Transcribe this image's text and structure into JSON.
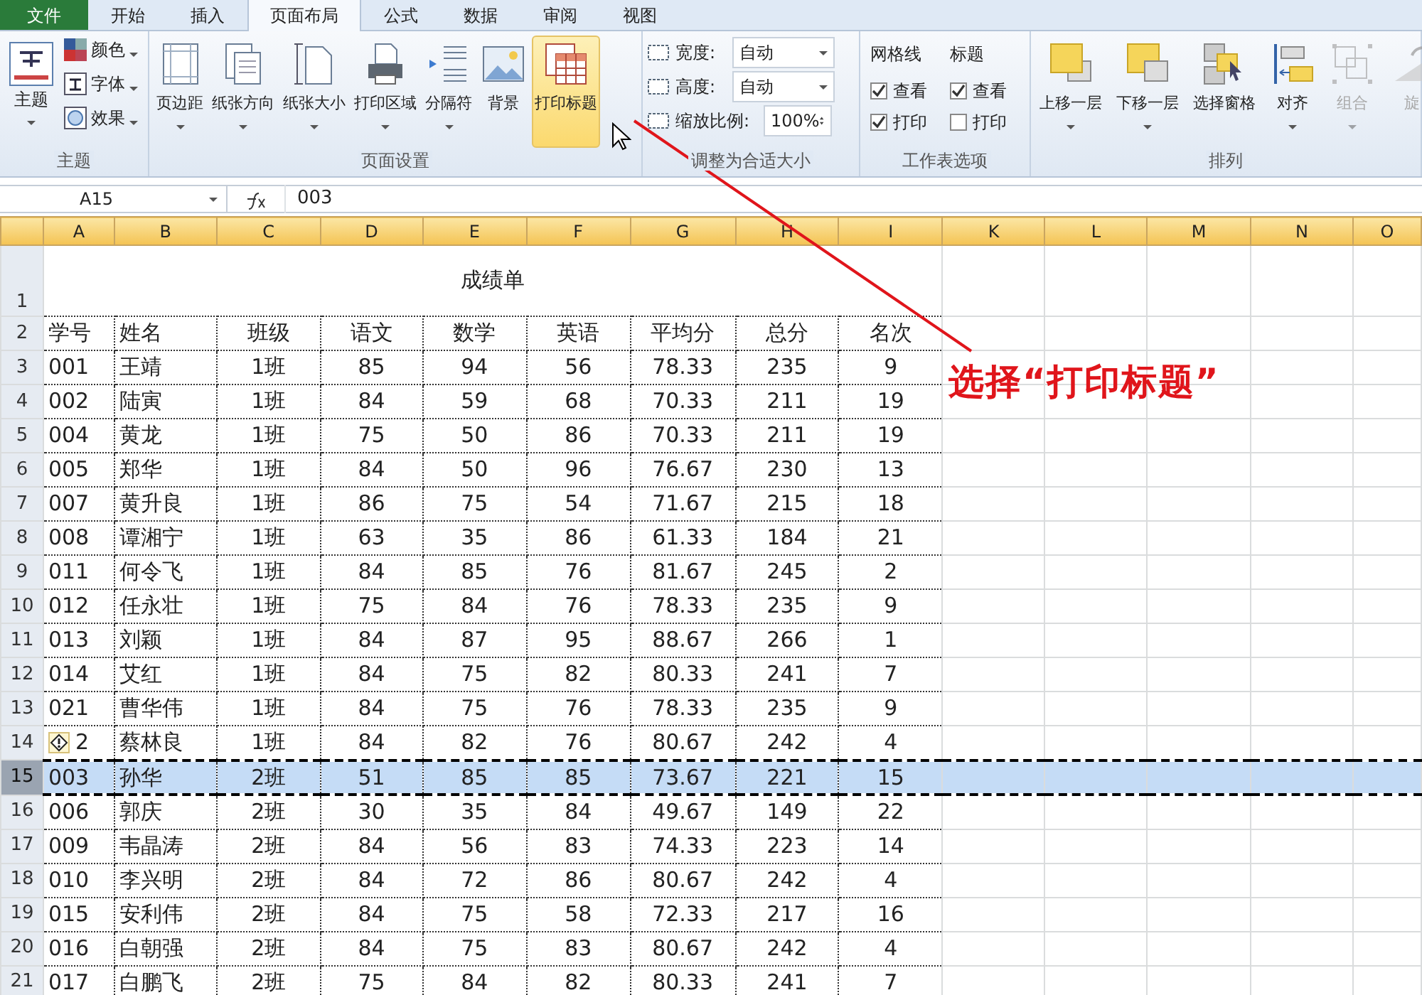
{
  "menu_tabs": [
    {
      "label": "文件",
      "kind": "file",
      "selected": false
    },
    {
      "label": "开始",
      "kind": "tab",
      "selected": false
    },
    {
      "label": "插入",
      "kind": "tab",
      "selected": false
    },
    {
      "label": "页面布局",
      "kind": "tab",
      "selected": true
    },
    {
      "label": "公式",
      "kind": "tab",
      "selected": false
    },
    {
      "label": "数据",
      "kind": "tab",
      "selected": false
    },
    {
      "label": "审阅",
      "kind": "tab",
      "selected": false
    },
    {
      "label": "视图",
      "kind": "tab",
      "selected": false
    }
  ],
  "theme_group": {
    "label": "主题",
    "main_button": "主题",
    "items": [
      "颜色",
      "字体",
      "效果"
    ]
  },
  "page_setup_group": {
    "label": "页面设置",
    "buttons": [
      {
        "label": "页边距",
        "dropdown": true,
        "hovered": false
      },
      {
        "label": "纸张方向",
        "dropdown": true,
        "hovered": false
      },
      {
        "label": "纸张大小",
        "dropdown": true,
        "hovered": false
      },
      {
        "label": "打印区域",
        "dropdown": true,
        "hovered": false
      },
      {
        "label": "分隔符",
        "dropdown": true,
        "hovered": false
      },
      {
        "label": "背景",
        "dropdown": false,
        "hovered": false
      },
      {
        "label": "打印标题",
        "dropdown": false,
        "hovered": true
      }
    ]
  },
  "scale_group": {
    "label": "调整为合适大小",
    "fields": [
      {
        "label": "宽度:",
        "value": "自动",
        "kind": "dropdown"
      },
      {
        "label": "高度:",
        "value": "自动",
        "kind": "dropdown"
      },
      {
        "label": "缩放比例:",
        "value": "100%",
        "kind": "spinner"
      }
    ]
  },
  "sheet_options_group": {
    "label": "工作表选项",
    "columns": [
      {
        "heading": "网格线",
        "options": [
          {
            "label": "查看",
            "checked": true
          },
          {
            "label": "打印",
            "checked": true
          }
        ]
      },
      {
        "heading": "标题",
        "options": [
          {
            "label": "查看",
            "checked": true
          },
          {
            "label": "打印",
            "checked": false
          }
        ]
      }
    ]
  },
  "arrange_group": {
    "label": "排列",
    "buttons": [
      {
        "label": "上移一层",
        "disabled": false
      },
      {
        "label": "下移一层",
        "disabled": false
      },
      {
        "label": "选择窗格",
        "disabled": false
      },
      {
        "label": "对齐",
        "disabled": false
      },
      {
        "label": "组合",
        "disabled": true
      },
      {
        "label": "旋",
        "disabled": true
      }
    ]
  },
  "formula_bar": {
    "name_box": "A15",
    "formula": "003"
  },
  "sheet": {
    "columns": [
      "A",
      "B",
      "C",
      "D",
      "E",
      "F",
      "G",
      "H",
      "I",
      "K",
      "L",
      "M",
      "N",
      "O"
    ],
    "title_row_number": "1",
    "header_row_number": "2",
    "title": "成绩单",
    "header": [
      "学号",
      "姓名",
      "班级",
      "语文",
      "数学",
      "英语",
      "平均分",
      "总分",
      "名次"
    ],
    "rows": [
      {
        "cells": [
          "001",
          "王靖",
          "1班",
          "85",
          "94",
          "56",
          "78.33",
          "235",
          "9"
        ],
        "warning": false,
        "selected": false,
        "row_number": "3"
      },
      {
        "cells": [
          "002",
          "陆寅",
          "1班",
          "84",
          "59",
          "68",
          "70.33",
          "211",
          "19"
        ],
        "warning": false,
        "selected": false,
        "row_number": "4"
      },
      {
        "cells": [
          "004",
          "黄龙",
          "1班",
          "75",
          "50",
          "86",
          "70.33",
          "211",
          "19"
        ],
        "warning": false,
        "selected": false,
        "row_number": "5"
      },
      {
        "cells": [
          "005",
          "郑华",
          "1班",
          "84",
          "50",
          "96",
          "76.67",
          "230",
          "13"
        ],
        "warning": false,
        "selected": false,
        "row_number": "6"
      },
      {
        "cells": [
          "007",
          "黄升良",
          "1班",
          "86",
          "75",
          "54",
          "71.67",
          "215",
          "18"
        ],
        "warning": false,
        "selected": false,
        "row_number": "7"
      },
      {
        "cells": [
          "008",
          "谭湘宁",
          "1班",
          "63",
          "35",
          "86",
          "61.33",
          "184",
          "21"
        ],
        "warning": false,
        "selected": false,
        "row_number": "8"
      },
      {
        "cells": [
          "011",
          "何令飞",
          "1班",
          "84",
          "85",
          "76",
          "81.67",
          "245",
          "2"
        ],
        "warning": false,
        "selected": false,
        "row_number": "9"
      },
      {
        "cells": [
          "012",
          "任永壮",
          "1班",
          "75",
          "84",
          "76",
          "78.33",
          "235",
          "9"
        ],
        "warning": false,
        "selected": false,
        "row_number": "10"
      },
      {
        "cells": [
          "013",
          "刘颖",
          "1班",
          "84",
          "87",
          "95",
          "88.67",
          "266",
          "1"
        ],
        "warning": false,
        "selected": false,
        "row_number": "11"
      },
      {
        "cells": [
          "014",
          "艾红",
          "1班",
          "84",
          "75",
          "82",
          "80.33",
          "241",
          "7"
        ],
        "warning": false,
        "selected": false,
        "row_number": "12"
      },
      {
        "cells": [
          "021",
          "曹华伟",
          "1班",
          "84",
          "75",
          "76",
          "78.33",
          "235",
          "9"
        ],
        "warning": false,
        "selected": false,
        "row_number": "13"
      },
      {
        "cells": [
          "2",
          "蔡林良",
          "1班",
          "84",
          "82",
          "76",
          "80.67",
          "242",
          "4"
        ],
        "warning": true,
        "selected": false,
        "row_number": "14"
      },
      {
        "cells": [
          "003",
          "孙华",
          "2班",
          "51",
          "85",
          "85",
          "73.67",
          "221",
          "15"
        ],
        "warning": false,
        "selected": true,
        "row_number": "15"
      },
      {
        "cells": [
          "006",
          "郭庆",
          "2班",
          "30",
          "35",
          "84",
          "49.67",
          "149",
          "22"
        ],
        "warning": false,
        "selected": false,
        "row_number": "16"
      },
      {
        "cells": [
          "009",
          "韦晶涛",
          "2班",
          "84",
          "56",
          "83",
          "74.33",
          "223",
          "14"
        ],
        "warning": false,
        "selected": false,
        "row_number": "17"
      },
      {
        "cells": [
          "010",
          "李兴明",
          "2班",
          "84",
          "72",
          "86",
          "80.67",
          "242",
          "4"
        ],
        "warning": false,
        "selected": false,
        "row_number": "18"
      },
      {
        "cells": [
          "015",
          "安利伟",
          "2班",
          "84",
          "75",
          "58",
          "72.33",
          "217",
          "16"
        ],
        "warning": false,
        "selected": false,
        "row_number": "19"
      },
      {
        "cells": [
          "016",
          "白朝强",
          "2班",
          "84",
          "75",
          "83",
          "80.67",
          "242",
          "4"
        ],
        "warning": false,
        "selected": false,
        "row_number": "20"
      },
      {
        "cells": [
          "017",
          "白鹏飞",
          "2班",
          "75",
          "84",
          "82",
          "80.33",
          "241",
          "7"
        ],
        "warning": false,
        "selected": false,
        "row_number": "21"
      }
    ]
  },
  "annotation": {
    "text": "选择“打印标题”"
  }
}
